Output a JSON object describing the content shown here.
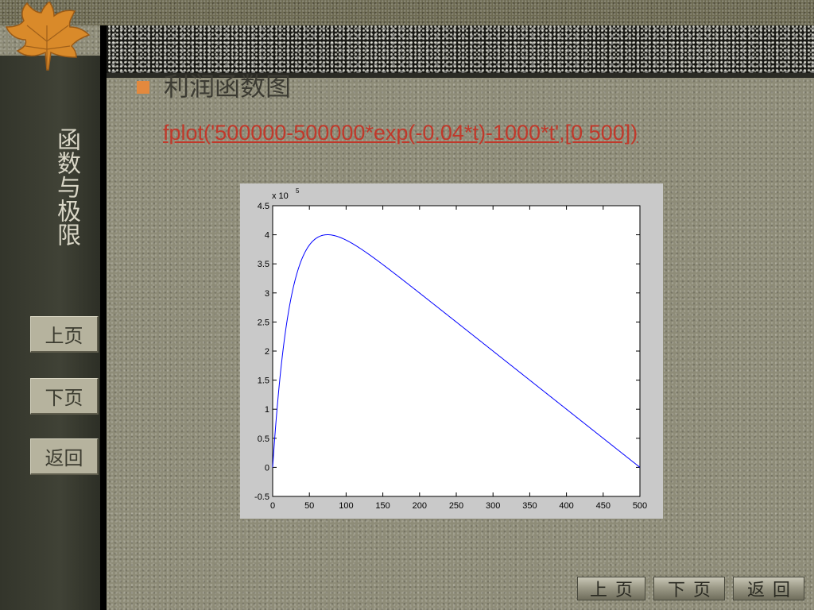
{
  "sidebar": {
    "title": "函数与极限",
    "buttons": {
      "prev": "上页",
      "next": "下页",
      "back": "返回"
    }
  },
  "slide": {
    "title": "利润函数图",
    "code": "fplot('500000-500000*exp(-0.04*t)-1000*t',[0 500])"
  },
  "bottom_nav": {
    "prev": "上页",
    "next": "下页",
    "back": "返回"
  },
  "colors": {
    "bullet": "#e3893e",
    "code_link": "#c0392b",
    "curve": "#0000ff"
  },
  "chart_data": {
    "type": "line",
    "function": "500000-500000*exp(-0.04*t)-1000*t",
    "xlim": [
      0,
      500
    ],
    "ylim": [
      -50000,
      450000
    ],
    "x_ticks": [
      0,
      50,
      100,
      150,
      200,
      250,
      300,
      350,
      400,
      450,
      500
    ],
    "y_ticks": [
      -0.5,
      0,
      0.5,
      1,
      1.5,
      2,
      2.5,
      3,
      3.5,
      4,
      4.5
    ],
    "y_multiplier": "x 10",
    "y_multiplier_exp": "5",
    "series": [
      {
        "x_range": [
          0,
          500
        ],
        "color": "#0000ff"
      }
    ]
  }
}
